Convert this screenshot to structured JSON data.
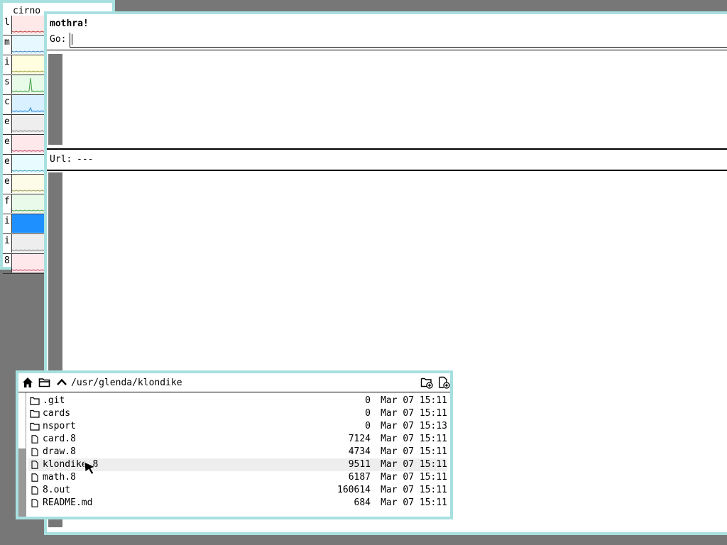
{
  "stats": {
    "title": "cirno",
    "rows": [
      {
        "letter": "l",
        "color": "#ffe8e8",
        "line": "#c04040"
      },
      {
        "letter": "m",
        "color": "#e8f8ff",
        "line": "#4080c0"
      },
      {
        "letter": "i",
        "color": "#ffffe0",
        "line": "#a0a040"
      },
      {
        "letter": "s",
        "color": "#e8fae8",
        "line": "#40a040"
      },
      {
        "letter": "c",
        "color": "#d8f0ff",
        "line": "#2080d0"
      },
      {
        "letter": "e",
        "color": "#eeeeee",
        "line": "#808080"
      },
      {
        "letter": "e",
        "color": "#ffe8ec",
        "line": "#c04060"
      },
      {
        "letter": "e",
        "color": "#e8fcff",
        "line": "#40a0c0"
      },
      {
        "letter": "e",
        "color": "#fcfce8",
        "line": "#a0a060"
      },
      {
        "letter": "f",
        "color": "#eafaea",
        "line": "#50a050"
      },
      {
        "letter": "i",
        "color": "#1e90ff",
        "line": "#1e90ff"
      },
      {
        "letter": "i",
        "color": "#eeeeee",
        "line": "#808080"
      },
      {
        "letter": "8",
        "color": "#ffe8ec",
        "line": "#c04060"
      }
    ]
  },
  "mothra": {
    "name": "mothra!",
    "go_label": "Go:",
    "go_value": "",
    "url_label": "Url:",
    "url_value": "---"
  },
  "files": {
    "path": "/usr/glenda/klondike",
    "entries": [
      {
        "type": "folder",
        "name": ".git",
        "size": "0",
        "date": "Mar 07 15:11"
      },
      {
        "type": "folder",
        "name": "cards",
        "size": "0",
        "date": "Mar 07 15:11"
      },
      {
        "type": "folder",
        "name": "nsport",
        "size": "0",
        "date": "Mar 07 15:13"
      },
      {
        "type": "file",
        "name": "card.8",
        "size": "7124",
        "date": "Mar 07 15:11"
      },
      {
        "type": "file",
        "name": "draw.8",
        "size": "4734",
        "date": "Mar 07 15:11"
      },
      {
        "type": "file",
        "name": "klondike.8",
        "size": "9511",
        "date": "Mar 07 15:11",
        "highlighted": true
      },
      {
        "type": "file",
        "name": "math.8",
        "size": "6187",
        "date": "Mar 07 15:11"
      },
      {
        "type": "file",
        "name": "8.out",
        "size": "160614",
        "date": "Mar 07 15:11"
      },
      {
        "type": "file",
        "name": "README.md",
        "size": "684",
        "date": "Mar 07 15:11"
      }
    ]
  },
  "colors": {
    "desktop": "#777777",
    "window_border": "#a8e0e0",
    "scroll_thumb": "#777777"
  }
}
